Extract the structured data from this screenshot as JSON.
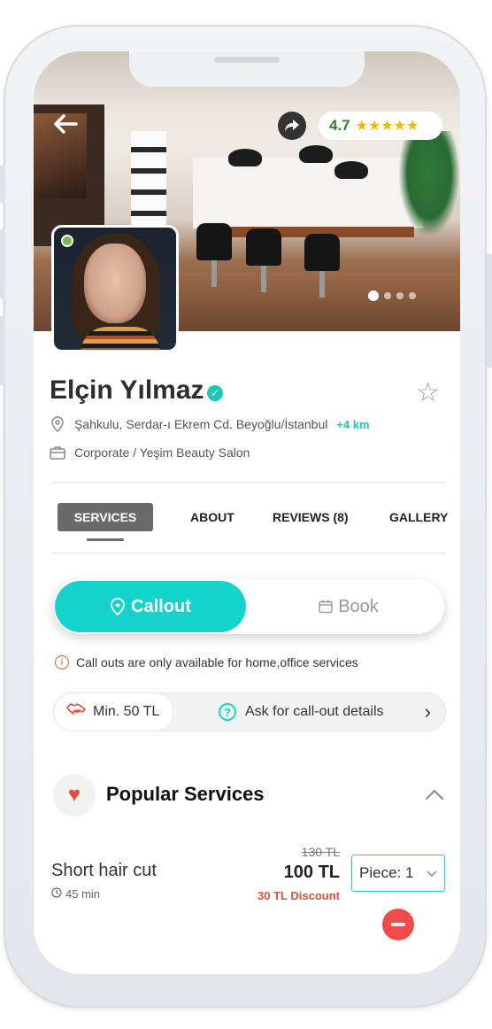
{
  "header": {
    "rating": "4.7",
    "stars": "★★★★★",
    "back_icon": "arrow-left-icon",
    "share_icon": "share-icon",
    "carousel_count": 4
  },
  "profile": {
    "name": "Elçin Yılmaz",
    "verified_icon": "✓",
    "favorite_icon": "☆",
    "address": "Şahkulu, Serdar-ı Ekrem Cd. Beyoğlu/İstanbul",
    "distance": "+4 km",
    "company": "Corporate / Yeşim Beauty Salon"
  },
  "tabs": [
    {
      "label": "SERVICES",
      "active": true
    },
    {
      "label": "ABOUT",
      "active": false
    },
    {
      "label": "REVIEWS (8)",
      "active": false
    },
    {
      "label": "GALLERY",
      "active": false
    }
  ],
  "toggle": {
    "callout_label": "Callout",
    "book_label": "Book"
  },
  "notice": {
    "icon": "i",
    "text": "Call outs are only available for home,office services"
  },
  "callout_bar": {
    "min_label": "Min. 50 TL",
    "ask_icon": "?",
    "ask_label": "Ask for call-out details",
    "chevron": "›"
  },
  "popular": {
    "title": "Popular Services",
    "heart_icon": "♥",
    "collapse_icon": "︿"
  },
  "service": {
    "name": "Short hair cut",
    "duration": "45 min",
    "old_price": "130 TL",
    "price": "100 TL",
    "discount": "30 TL Discount",
    "piece_label": "Piece: 1",
    "piece_chevron": "⌄"
  },
  "colors": {
    "accent": "#14d3cc",
    "danger": "#f04b4b",
    "rating": "#2e7d32",
    "star": "#f7b500"
  }
}
